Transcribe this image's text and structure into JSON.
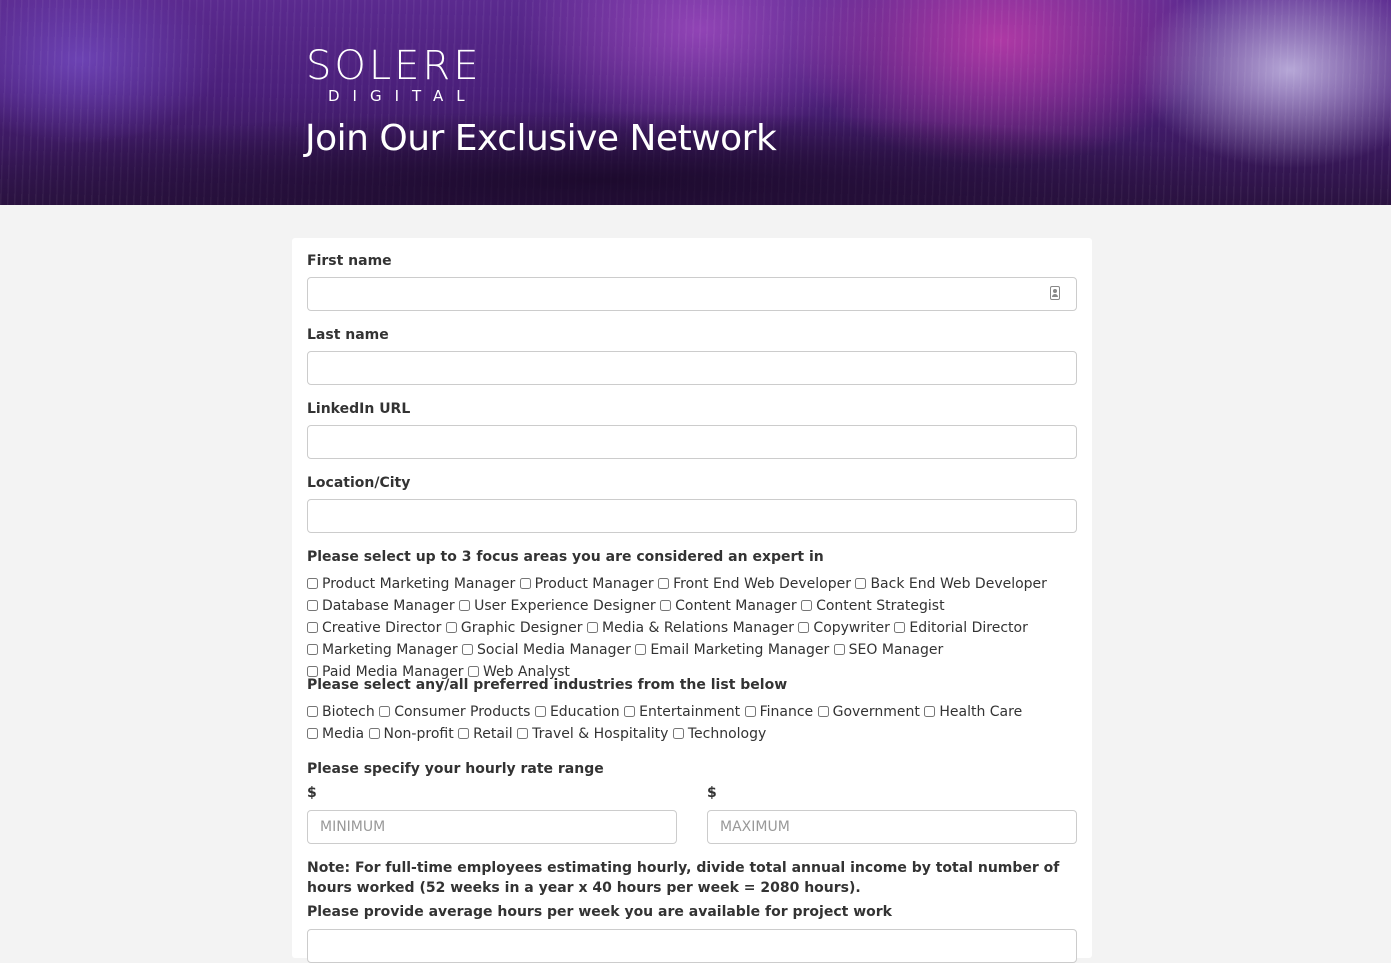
{
  "header": {
    "logo_main": "SOLERE",
    "logo_sub": "DIGITAL",
    "title": "Join Our Exclusive Network"
  },
  "form": {
    "first_name": {
      "label": "First name",
      "value": ""
    },
    "last_name": {
      "label": "Last name",
      "value": ""
    },
    "linkedin": {
      "label": "LinkedIn URL",
      "value": ""
    },
    "location": {
      "label": "Location/City",
      "value": ""
    },
    "focus": {
      "label": "Please select up to 3 focus areas you are considered an expert in",
      "options": [
        "Product Marketing Manager",
        "Product Manager",
        "Front End Web Developer",
        "Back End Web Developer",
        "Database Manager",
        "User Experience Designer",
        "Content Manager",
        "Content Strategist",
        "Creative Director",
        "Graphic Designer",
        "Media & Relations Manager",
        "Copywriter",
        "Editorial Director",
        "Marketing Manager",
        "Social Media Manager",
        "Email Marketing Manager",
        "SEO Manager",
        "Paid Media Manager",
        "Web Analyst"
      ]
    },
    "industries": {
      "label": "Please select any/all preferred industries from the list below",
      "options": [
        "Biotech",
        "Consumer Products",
        "Education",
        "Entertainment",
        "Finance",
        "Government",
        "Health Care",
        "Media",
        "Non-profit",
        "Retail",
        "Travel & Hospitality",
        "Technology"
      ]
    },
    "rate": {
      "label": "Please specify your hourly rate range",
      "currency": "$",
      "min_placeholder": "MINIMUM",
      "max_placeholder": "MAXIMUM"
    },
    "note": "Note: For full-time employees estimating hourly, divide total annual income by total number of hours worked (52 weeks in a year x 40 hours per week = 2080 hours).",
    "hours": {
      "label": "Please provide average hours per week you are available for project work"
    }
  }
}
